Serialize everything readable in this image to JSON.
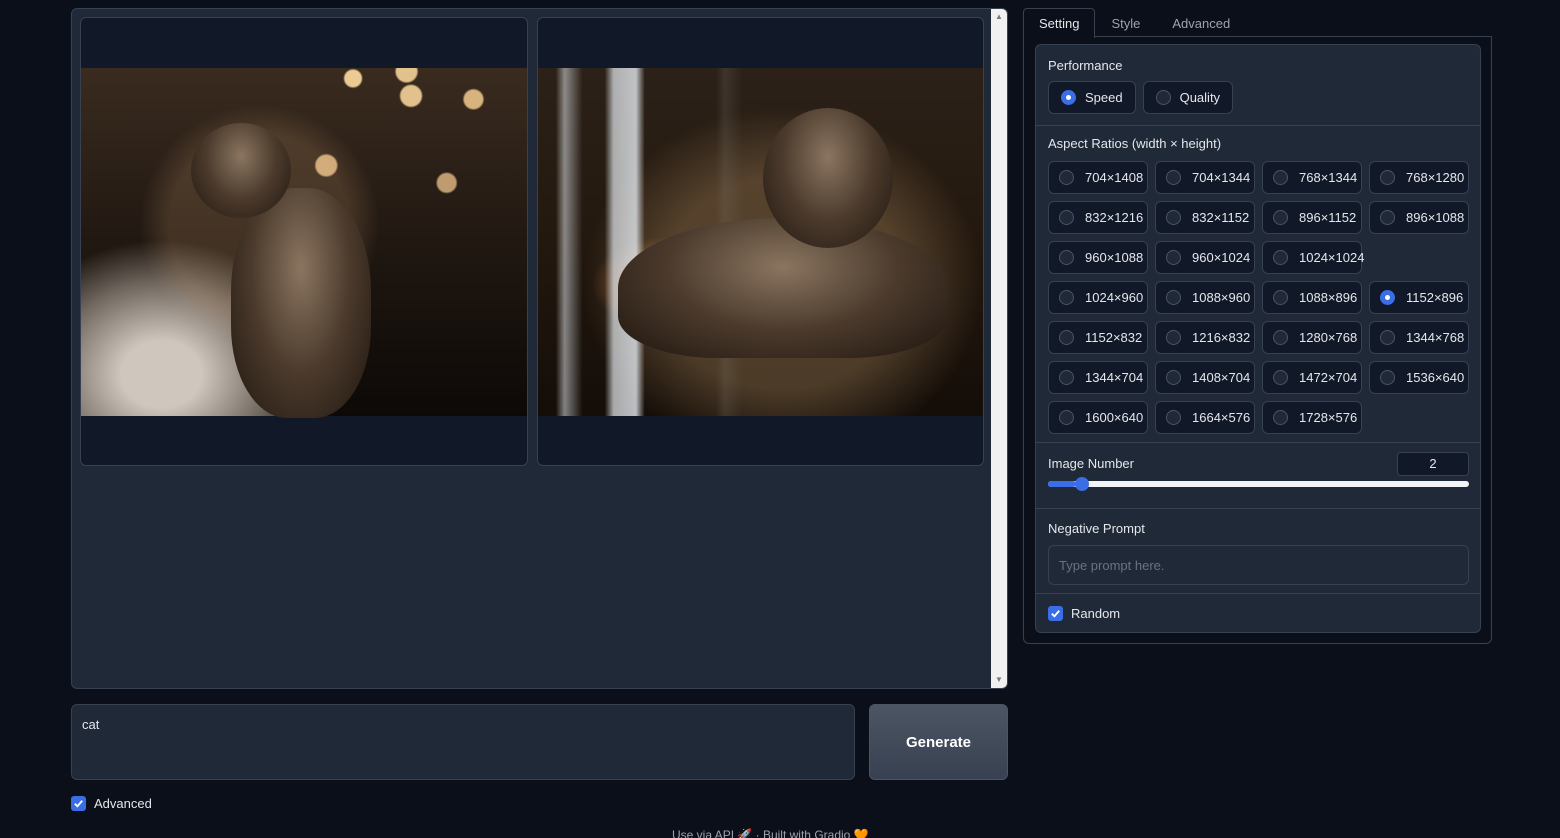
{
  "gallery": {
    "images": [
      {
        "alt": "cat"
      },
      {
        "alt": "cat"
      }
    ]
  },
  "prompt": {
    "value": "cat"
  },
  "generate": {
    "label": "Generate"
  },
  "advanced_toggle": {
    "label": "Advanced",
    "checked": true
  },
  "footer": {
    "text": "Use via API 🚀 · Built with Gradio 🧡"
  },
  "tabs": [
    {
      "label": "Setting",
      "active": true
    },
    {
      "label": "Style",
      "active": false
    },
    {
      "label": "Advanced",
      "active": false
    }
  ],
  "performance": {
    "label": "Performance",
    "options": [
      {
        "label": "Speed",
        "selected": true
      },
      {
        "label": "Quality",
        "selected": false
      }
    ]
  },
  "aspect": {
    "label": "Aspect Ratios (width × height)",
    "selected": "1152×896",
    "rows": [
      [
        "704×1408",
        "704×1344",
        "768×1344",
        "768×1280"
      ],
      [
        "832×1216",
        "832×1152",
        "896×1152",
        "896×1088"
      ],
      [
        "960×1088",
        "960×1024",
        "1024×1024"
      ],
      [
        "1024×960",
        "1088×960",
        "1088×896",
        "1152×896"
      ],
      [
        "1152×832",
        "1216×832",
        "1280×768",
        "1344×768"
      ],
      [
        "1344×704",
        "1408×704",
        "1472×704",
        "1536×640"
      ],
      [
        "1600×640",
        "1664×576",
        "1728×576"
      ]
    ]
  },
  "image_number": {
    "label": "Image Number",
    "value": "2",
    "min": 1,
    "max": 32
  },
  "negative_prompt": {
    "label": "Negative Prompt",
    "placeholder": "Type prompt here.",
    "value": ""
  },
  "random": {
    "label": "Random",
    "checked": true
  },
  "colors": {
    "accent": "#3b6ee6",
    "background": "#0b0f19",
    "panel": "#1f2937",
    "border": "#374151"
  }
}
